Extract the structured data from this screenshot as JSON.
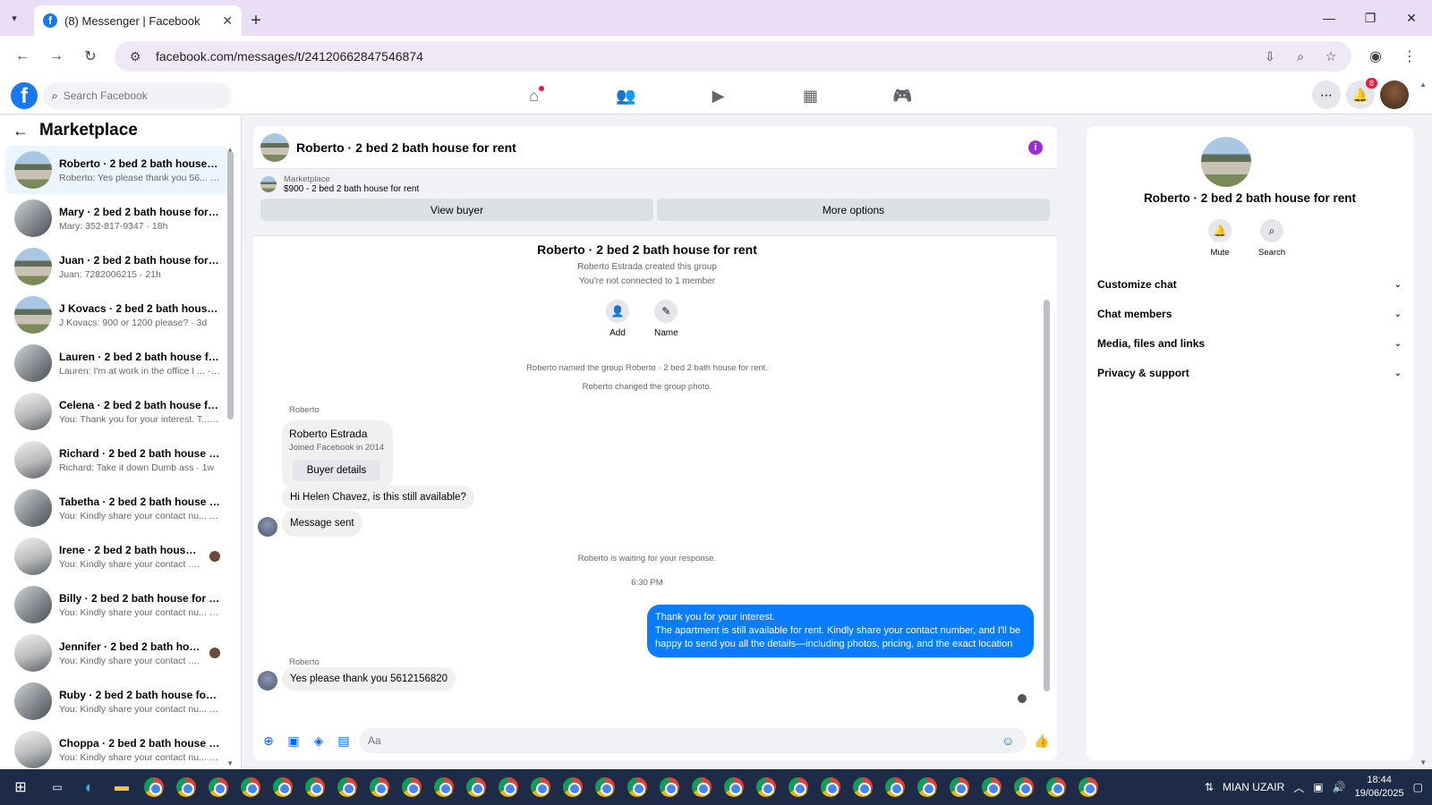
{
  "browser": {
    "tab_title": "(8) Messenger | Facebook",
    "url": "facebook.com/messages/t/24120662847546874"
  },
  "fb": {
    "search_placeholder": "Search Facebook",
    "notification_count": "8"
  },
  "sidebar": {
    "title": "Marketplace",
    "conversations": [
      {
        "name": "Roberto · 2 bed 2 bath house f...",
        "preview": "Roberto: Yes please thank you 56... · 1m",
        "thumb": "house"
      },
      {
        "name": "Mary · 2 bed 2 bath house for r...",
        "preview": "Mary: 352-817-9347 · 18h",
        "thumb": "room"
      },
      {
        "name": "Juan · 2 bed 2 bath house for re...",
        "preview": "Juan: 7282006215 · 21h",
        "thumb": "house"
      },
      {
        "name": "J Kovacs · 2 bed 2 bath house f...",
        "preview": "J Kovacs: 900 or 1200 please? · 3d",
        "thumb": "house"
      },
      {
        "name": "Lauren · 2 bed 2 bath house for...",
        "preview": "Lauren: I'm at work in the office I ... · 1w",
        "thumb": "room"
      },
      {
        "name": "Celena · 2 bed 2 bath house for...",
        "preview": "You: Thank you for your interest. T... · 1w",
        "thumb": "room2"
      },
      {
        "name": "Richard · 2 bed 2 bath house fo...",
        "preview": "Richard: Take it down Dumb ass · 1w",
        "thumb": "room2"
      },
      {
        "name": "Tabetha · 2 bed 2 bath house fo...",
        "preview": "You: Kindly share your contact nu... · 1w",
        "thumb": "room"
      },
      {
        "name": "Irene · 2 bed 2 bath house fo...",
        "preview": "You: Kindly share your contact ... · 1w",
        "thumb": "room2"
      },
      {
        "name": "Billy · 2 bed 2 bath house for rent",
        "preview": "You: Kindly share your contact nu... · 1w",
        "thumb": "room"
      },
      {
        "name": "Jennifer · 2 bed 2 bath house...",
        "preview": "You: Kindly share your contact ... · 1w",
        "thumb": "room2"
      },
      {
        "name": "Ruby · 2 bed 2 bath house for r...",
        "preview": "You: Kindly share your contact nu... · 1w",
        "thumb": "room"
      },
      {
        "name": "Choppa · 2 bed 2 bath house fo...",
        "preview": "You: Kindly share your contact nu... · 1w",
        "thumb": "room2"
      }
    ]
  },
  "chat": {
    "title": "Roberto · 2 bed 2 bath house for rent",
    "marketplace_label": "Marketplace",
    "listing": "$900 - 2 bed 2 bath house for rent",
    "view_buyer": "View buyer",
    "more_options": "More options",
    "group_title": "Roberto · 2 bed 2 bath house for rent",
    "created": "Roberto Estrada created this group",
    "not_connected": "You're not connected to 1 member",
    "add_label": "Add",
    "name_label": "Name",
    "event1": "Roberto named the group Roberto · 2 bed 2 bath house for rent.",
    "event2": "Roberto changed the group photo.",
    "sender1": "Roberto",
    "card_name": "Roberto Estrada",
    "card_sub": "Joined Facebook in 2014",
    "buyer_details": "Buyer details",
    "msg1": "Hi Helen Chavez, is this still available?",
    "msg2": "Message sent",
    "waiting": "Roberto is waiting for your response.",
    "time": "6:30 PM",
    "out_line1": "Thank you for your interest.",
    "out_line2": "The apartment is still available for rent. Kindly share your contact number, and I'll be happy to send you all the details—including photos, pricing, and the exact location",
    "sender2": "Roberto",
    "msg3": "Yes please thank you 5612156820",
    "composer_placeholder": "Aa"
  },
  "rpanel": {
    "title": "Roberto · 2 bed 2 bath house for rent",
    "mute": "Mute",
    "search": "Search",
    "items": [
      "Customize chat",
      "Chat members",
      "Media, files and links",
      "Privacy & support"
    ]
  },
  "taskbar": {
    "user": "MIAN UZAIR",
    "time": "18:44",
    "date": "19/06/2025"
  }
}
